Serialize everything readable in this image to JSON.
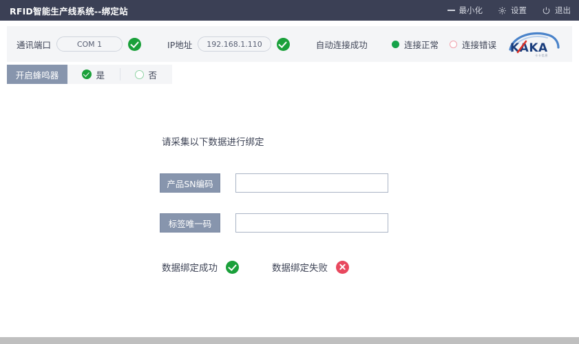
{
  "window": {
    "title": "RFID智能生产线系统--绑定站",
    "actions": [
      {
        "label": "最小化",
        "icon": "minimize-icon"
      },
      {
        "label": "设置",
        "icon": "gear-icon"
      },
      {
        "label": "退出",
        "icon": "power-icon"
      }
    ]
  },
  "toolbar": {
    "port_label": "通讯端口",
    "port_value": "COM 1",
    "port_status_icon": "check-circle-icon",
    "ip_label": "IP地址",
    "ip_value": "192.168.1.110",
    "ip_status_icon": "check-circle-icon",
    "connect_message": "自动连接成功",
    "status_ok_label": "连接正常",
    "status_ok_icon": "filled-dot-icon",
    "status_error_label": "连接错误",
    "status_error_icon": "hollow-dot-icon",
    "logo_text": "KAKA",
    "logo_subtext": "卡卡信息"
  },
  "buzzer": {
    "label": "开启蜂鸣器",
    "yes_label": "是",
    "yes_icon": "check-circle-icon",
    "no_label": "否",
    "no_icon": "hollow-circle-icon"
  },
  "main": {
    "prompt": "请采集以下数据进行绑定",
    "fields": [
      {
        "label": "产品SN编码",
        "value": "",
        "placeholder": "",
        "status_icon": "check-circle-icon"
      },
      {
        "label": "标签唯一码",
        "value": "",
        "placeholder": "",
        "status_icon": "check-circle-icon"
      }
    ],
    "results": [
      {
        "label": "数据绑定成功",
        "icon": "check-circle-icon"
      },
      {
        "label": "数据绑定失败",
        "icon": "x-circle-icon"
      }
    ]
  },
  "colors": {
    "titlebar_bg": "#3b4055",
    "toolbar_bg": "#f4f5f7",
    "label_bg": "#8795ad",
    "success_green": "#1aa03a",
    "error_red": "#e8485e",
    "logo_blue": "#1a4a96",
    "logo_red": "#e03127"
  }
}
